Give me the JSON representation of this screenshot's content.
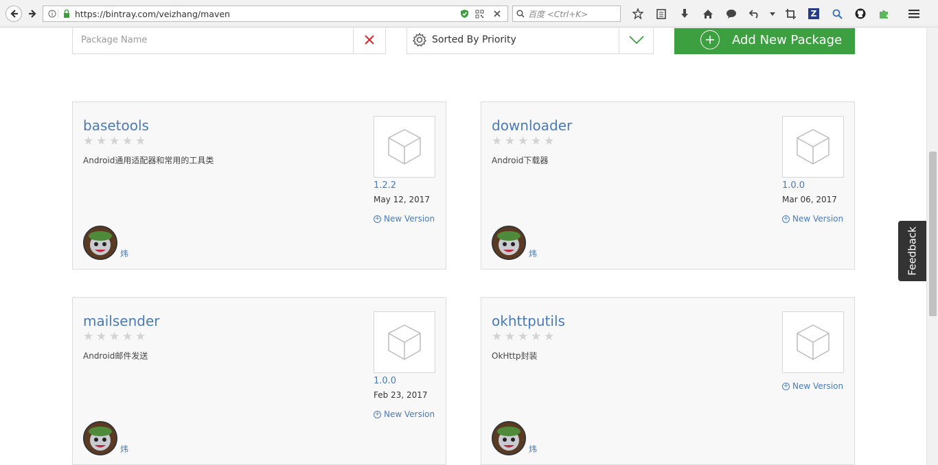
{
  "browser": {
    "url": "https://bintray.com/veizhang/maven",
    "search_placeholder": "百度 <Ctrl+K>"
  },
  "filter": {
    "placeholder": "Package Name"
  },
  "sort": {
    "label": "Sorted By Priority"
  },
  "add_button": {
    "label": "Add New Package"
  },
  "feedback": {
    "label": "Feedback"
  },
  "new_version_label": "New Version",
  "packages": [
    {
      "name": "basetools",
      "description": "Android通用适配器和常用的工具类",
      "version": "1.2.2",
      "date": "May 12, 2017",
      "owner": "炜",
      "rating": 0
    },
    {
      "name": "downloader",
      "description": "Android下载器",
      "version": "1.0.0",
      "date": "Mar 06, 2017",
      "owner": "炜",
      "rating": 0
    },
    {
      "name": "mailsender",
      "description": "Android邮件发送",
      "version": "1.0.0",
      "date": "Feb 23, 2017",
      "owner": "炜",
      "rating": 0
    },
    {
      "name": "okhttputils",
      "description": "OkHttp封装",
      "version": "",
      "date": "",
      "owner": "炜",
      "rating": 0
    }
  ],
  "colors": {
    "accent_green": "#3c9f40",
    "link_blue": "#4a7ab5",
    "clear_red": "#d9262c"
  }
}
